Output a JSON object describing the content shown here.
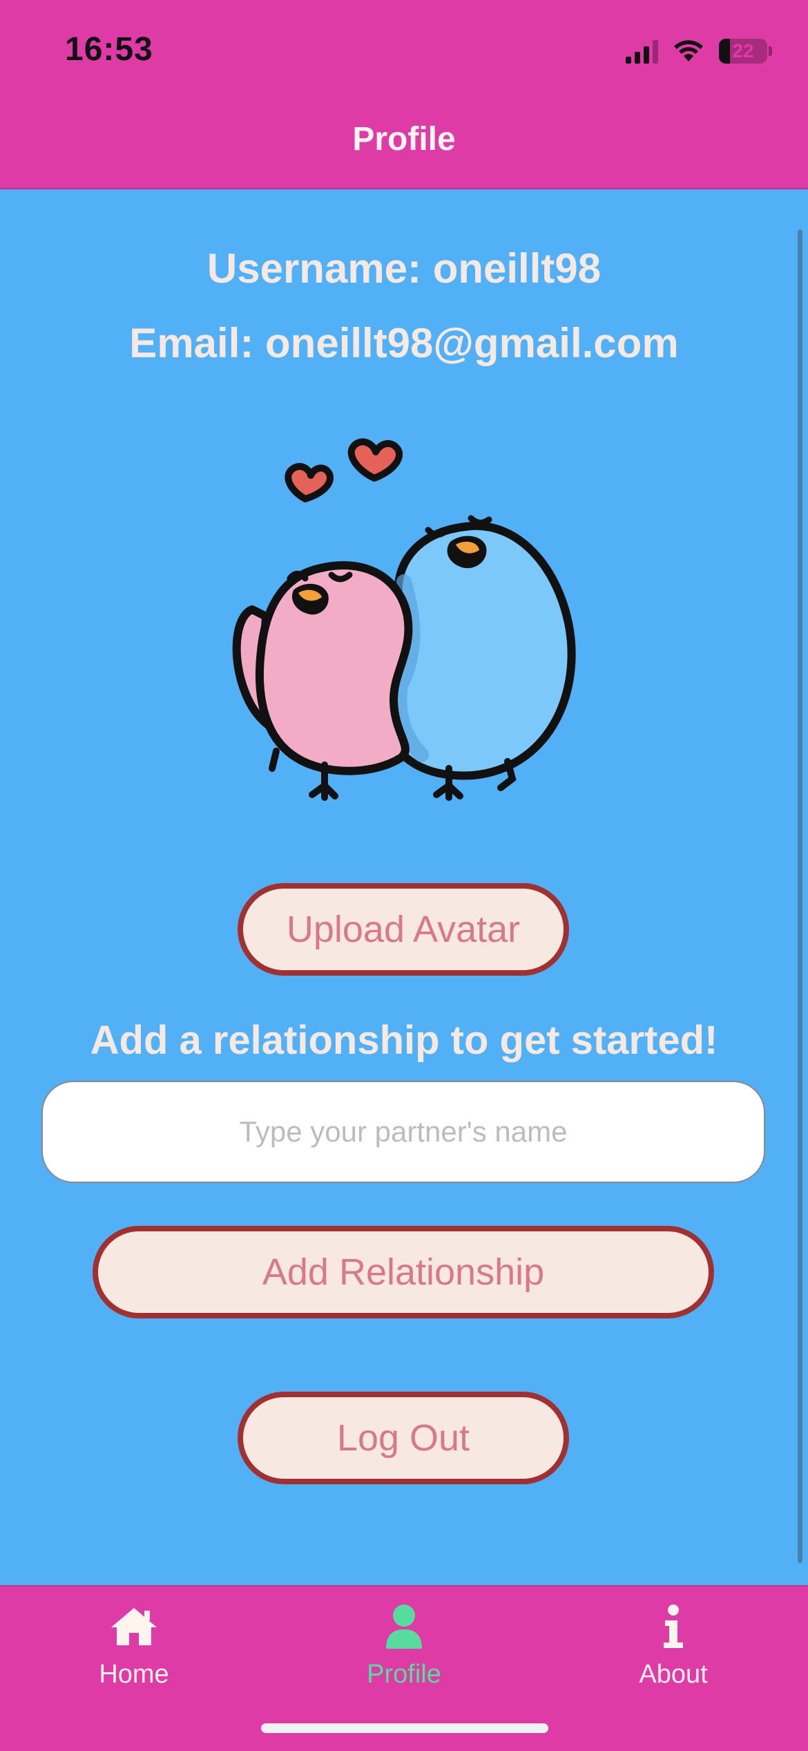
{
  "status": {
    "time": "16:53",
    "battery": "22"
  },
  "header": {
    "title": "Profile"
  },
  "profile": {
    "username_line": "Username: oneillt98",
    "email_line": "Email: oneillt98@gmail.com",
    "avatar_icon": "love-birds-illustration"
  },
  "actions": {
    "upload_avatar_label": "Upload Avatar",
    "prompt": "Add a relationship to get started!",
    "partner_placeholder": "Type your partner's name",
    "partner_value": "",
    "add_relationship_label": "Add Relationship",
    "logout_label": "Log Out"
  },
  "tabs": [
    {
      "label": "Home",
      "icon": "home-icon",
      "active": false
    },
    {
      "label": "Profile",
      "icon": "person-icon",
      "active": true
    },
    {
      "label": "About",
      "icon": "info-icon",
      "active": false
    }
  ],
  "colors": {
    "header_bg": "#df3ba7",
    "content_bg": "#52b0f6",
    "button_bg": "#f7e8e1",
    "button_border": "#a13131",
    "button_text": "#d87a86",
    "active_tab": "#57dc9d"
  }
}
